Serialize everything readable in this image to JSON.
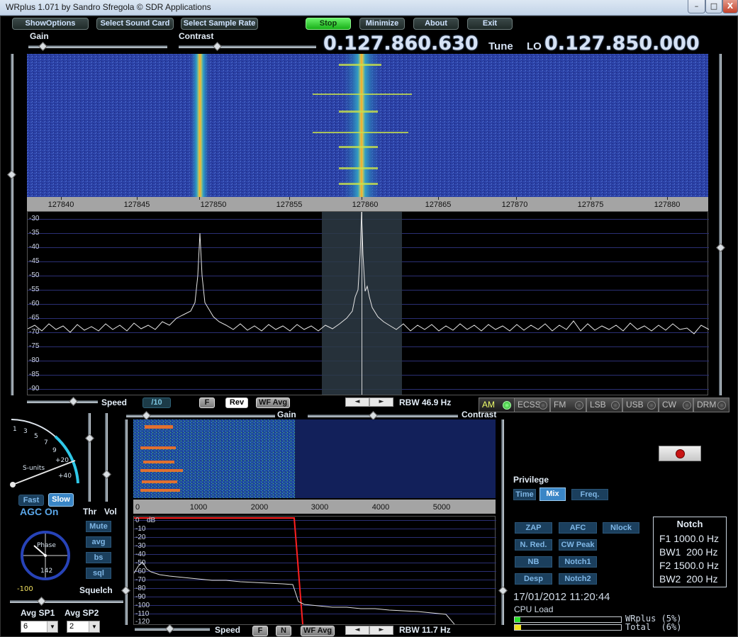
{
  "window": {
    "title": "WRplus 1.071 by Sandro Sfregola © SDR Applications",
    "minimize_glyph": "–",
    "maximize_glyph": "□",
    "close_glyph": "X"
  },
  "toolbar": {
    "show_options": "ShowOptions",
    "select_sound_card": "Select Sound Card",
    "select_sample_rate": "Select Sample Rate",
    "stop": "Stop",
    "minimize": "Minimize",
    "about": "About",
    "exit": "Exit"
  },
  "top_controls": {
    "gain_label": "Gain",
    "contrast_label": "Contrast"
  },
  "frequency": {
    "tune_value": "0.127.860.630",
    "tune_label": "Tune",
    "lo_label": "LO",
    "lo_value": "0.127.850.000"
  },
  "waterfall_axis": {
    "ticks": [
      "127840",
      "127845",
      "127850",
      "127855",
      "127860",
      "127865",
      "127870",
      "127875",
      "127880"
    ]
  },
  "spectrum": {
    "y_ticks": [
      "-30",
      "-35",
      "-40",
      "-45",
      "-50",
      "-55",
      "-60",
      "-65",
      "-70",
      "-75",
      "-80",
      "-85",
      "-90"
    ]
  },
  "spectrum_controls": {
    "speed_label": "Speed",
    "speed_value": "/10",
    "f_button": "F",
    "rev_button": "Rev",
    "wfavg_button": "WF Avg",
    "rbw": "RBW 46.9 Hz"
  },
  "modes": [
    {
      "label": "AM",
      "active": true
    },
    {
      "label": "ECSS",
      "active": false
    },
    {
      "label": "FM",
      "active": false
    },
    {
      "label": "LSB",
      "active": false
    },
    {
      "label": "USB",
      "active": false
    },
    {
      "label": "CW",
      "active": false
    },
    {
      "label": "DRM",
      "active": false
    }
  ],
  "smeter": {
    "scale_labels": [
      "1",
      "3",
      "5",
      "7",
      "9",
      "+20",
      "+40"
    ],
    "units_label": "S-units"
  },
  "agc": {
    "fast": "Fast",
    "slow": "Slow",
    "status": "AGC On"
  },
  "audio": {
    "thr_label": "Thr",
    "vol_label": "Vol",
    "mute": "Mute",
    "avg": "avg",
    "bs": "bs",
    "sql": "sql"
  },
  "phase": {
    "label": "Phase",
    "value": "142",
    "min_value": "-100"
  },
  "squelch_label": "Squelch",
  "avg": {
    "sp1_label": "Avg SP1",
    "sp2_label": "Avg SP2",
    "sp1_value": "6",
    "sp2_value": "2"
  },
  "audio_panel": {
    "gain_label": "Gain",
    "contrast_label": "Contrast",
    "axis_ticks": [
      "0",
      "1000",
      "2000",
      "3000",
      "4000",
      "5000"
    ],
    "y_ticks": [
      "0",
      "-10",
      "-20",
      "-30",
      "-40",
      "-50",
      "-60",
      "-70",
      "-80",
      "-90",
      "-100",
      "-110",
      "-120"
    ],
    "y_unit": "dB",
    "speed_label": "Speed",
    "f_button": "F",
    "n_button": "N",
    "wfavg_button": "WF Avg",
    "rbw": "RBW 11.7 Hz"
  },
  "privilege": {
    "label": "Privilege",
    "time": "Time",
    "mix": "Mix",
    "freq": "Freq."
  },
  "dsp_buttons": {
    "zap": "ZAP",
    "afc": "AFC",
    "nlock": "Nlock",
    "nred": "N. Red.",
    "cwpeak": "CW Peak",
    "nb": "NB",
    "notch1": "Notch1",
    "desp": "Desp",
    "notch2": "Notch2"
  },
  "notch": {
    "title": "Notch",
    "f1": "F1 1000.0 Hz",
    "bw1": "BW1  200 Hz",
    "f2": "F2 1500.0 Hz",
    "bw2": "BW2  200 Hz"
  },
  "status": {
    "datetime": "17/01/2012 11:20:44",
    "cpu_label": "CPU Load",
    "wrplus_load": "WRplus (5%)",
    "total_load": "Total  (6%)",
    "wrplus_percent": 5,
    "total_percent": 6
  },
  "colors": {
    "accent_blue": "#3a86c6",
    "stop_green": "#17b017",
    "waterfall_bg": "#2b40a6",
    "trace_red": "#ff2020"
  }
}
